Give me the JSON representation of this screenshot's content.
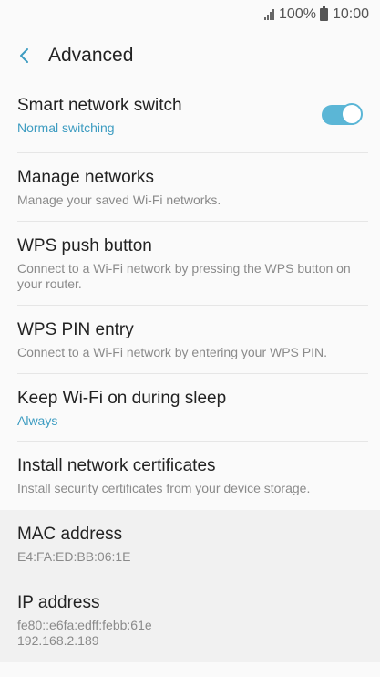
{
  "status_bar": {
    "battery_percent": "100%",
    "time": "10:00",
    "icons": [
      "signal-icon",
      "battery-icon"
    ]
  },
  "app_bar": {
    "back_icon": "back-arrow-icon",
    "title": "Advanced"
  },
  "colors": {
    "accent": "#3d9cc1",
    "toggle_on": "#5bb6d6",
    "background": "#fafafa",
    "info_background": "#f1f1f1"
  },
  "settings": {
    "smart_switch": {
      "title": "Smart network switch",
      "subtitle": "Normal switching",
      "toggle_on": true
    },
    "manage_networks": {
      "title": "Manage networks",
      "subtitle": "Manage your saved Wi-Fi networks."
    },
    "wps_push": {
      "title": "WPS push button",
      "subtitle": "Connect to a Wi-Fi network by pressing the WPS button on your router."
    },
    "wps_pin": {
      "title": "WPS PIN entry",
      "subtitle": "Connect to a Wi-Fi network by entering your WPS PIN."
    },
    "keep_wifi": {
      "title": "Keep Wi-Fi on during sleep",
      "subtitle": "Always"
    },
    "install_certs": {
      "title": "Install network certificates",
      "subtitle": "Install security certificates from your device storage."
    }
  },
  "info": {
    "mac": {
      "title": "MAC address",
      "value": "E4:FA:ED:BB:06:1E"
    },
    "ip": {
      "title": "IP address",
      "ipv6": "fe80::e6fa:edff:febb:61e",
      "ipv4": "192.168.2.189"
    }
  }
}
